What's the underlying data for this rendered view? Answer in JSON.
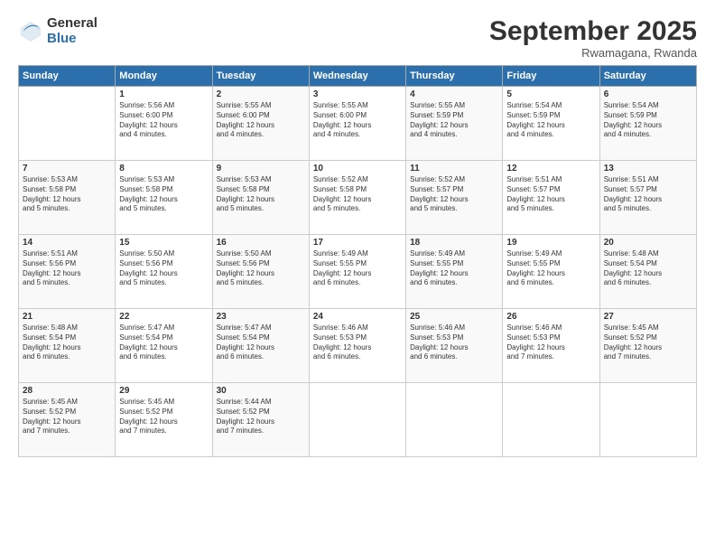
{
  "logo": {
    "general": "General",
    "blue": "Blue"
  },
  "header": {
    "month": "September 2025",
    "location": "Rwamagana, Rwanda"
  },
  "days": [
    "Sunday",
    "Monday",
    "Tuesday",
    "Wednesday",
    "Thursday",
    "Friday",
    "Saturday"
  ],
  "weeks": [
    [
      {
        "num": "",
        "lines": []
      },
      {
        "num": "1",
        "lines": [
          "Sunrise: 5:56 AM",
          "Sunset: 6:00 PM",
          "Daylight: 12 hours",
          "and 4 minutes."
        ]
      },
      {
        "num": "2",
        "lines": [
          "Sunrise: 5:55 AM",
          "Sunset: 6:00 PM",
          "Daylight: 12 hours",
          "and 4 minutes."
        ]
      },
      {
        "num": "3",
        "lines": [
          "Sunrise: 5:55 AM",
          "Sunset: 6:00 PM",
          "Daylight: 12 hours",
          "and 4 minutes."
        ]
      },
      {
        "num": "4",
        "lines": [
          "Sunrise: 5:55 AM",
          "Sunset: 5:59 PM",
          "Daylight: 12 hours",
          "and 4 minutes."
        ]
      },
      {
        "num": "5",
        "lines": [
          "Sunrise: 5:54 AM",
          "Sunset: 5:59 PM",
          "Daylight: 12 hours",
          "and 4 minutes."
        ]
      },
      {
        "num": "6",
        "lines": [
          "Sunrise: 5:54 AM",
          "Sunset: 5:59 PM",
          "Daylight: 12 hours",
          "and 4 minutes."
        ]
      }
    ],
    [
      {
        "num": "7",
        "lines": [
          "Sunrise: 5:53 AM",
          "Sunset: 5:58 PM",
          "Daylight: 12 hours",
          "and 5 minutes."
        ]
      },
      {
        "num": "8",
        "lines": [
          "Sunrise: 5:53 AM",
          "Sunset: 5:58 PM",
          "Daylight: 12 hours",
          "and 5 minutes."
        ]
      },
      {
        "num": "9",
        "lines": [
          "Sunrise: 5:53 AM",
          "Sunset: 5:58 PM",
          "Daylight: 12 hours",
          "and 5 minutes."
        ]
      },
      {
        "num": "10",
        "lines": [
          "Sunrise: 5:52 AM",
          "Sunset: 5:58 PM",
          "Daylight: 12 hours",
          "and 5 minutes."
        ]
      },
      {
        "num": "11",
        "lines": [
          "Sunrise: 5:52 AM",
          "Sunset: 5:57 PM",
          "Daylight: 12 hours",
          "and 5 minutes."
        ]
      },
      {
        "num": "12",
        "lines": [
          "Sunrise: 5:51 AM",
          "Sunset: 5:57 PM",
          "Daylight: 12 hours",
          "and 5 minutes."
        ]
      },
      {
        "num": "13",
        "lines": [
          "Sunrise: 5:51 AM",
          "Sunset: 5:57 PM",
          "Daylight: 12 hours",
          "and 5 minutes."
        ]
      }
    ],
    [
      {
        "num": "14",
        "lines": [
          "Sunrise: 5:51 AM",
          "Sunset: 5:56 PM",
          "Daylight: 12 hours",
          "and 5 minutes."
        ]
      },
      {
        "num": "15",
        "lines": [
          "Sunrise: 5:50 AM",
          "Sunset: 5:56 PM",
          "Daylight: 12 hours",
          "and 5 minutes."
        ]
      },
      {
        "num": "16",
        "lines": [
          "Sunrise: 5:50 AM",
          "Sunset: 5:56 PM",
          "Daylight: 12 hours",
          "and 5 minutes."
        ]
      },
      {
        "num": "17",
        "lines": [
          "Sunrise: 5:49 AM",
          "Sunset: 5:55 PM",
          "Daylight: 12 hours",
          "and 6 minutes."
        ]
      },
      {
        "num": "18",
        "lines": [
          "Sunrise: 5:49 AM",
          "Sunset: 5:55 PM",
          "Daylight: 12 hours",
          "and 6 minutes."
        ]
      },
      {
        "num": "19",
        "lines": [
          "Sunrise: 5:49 AM",
          "Sunset: 5:55 PM",
          "Daylight: 12 hours",
          "and 6 minutes."
        ]
      },
      {
        "num": "20",
        "lines": [
          "Sunrise: 5:48 AM",
          "Sunset: 5:54 PM",
          "Daylight: 12 hours",
          "and 6 minutes."
        ]
      }
    ],
    [
      {
        "num": "21",
        "lines": [
          "Sunrise: 5:48 AM",
          "Sunset: 5:54 PM",
          "Daylight: 12 hours",
          "and 6 minutes."
        ]
      },
      {
        "num": "22",
        "lines": [
          "Sunrise: 5:47 AM",
          "Sunset: 5:54 PM",
          "Daylight: 12 hours",
          "and 6 minutes."
        ]
      },
      {
        "num": "23",
        "lines": [
          "Sunrise: 5:47 AM",
          "Sunset: 5:54 PM",
          "Daylight: 12 hours",
          "and 6 minutes."
        ]
      },
      {
        "num": "24",
        "lines": [
          "Sunrise: 5:46 AM",
          "Sunset: 5:53 PM",
          "Daylight: 12 hours",
          "and 6 minutes."
        ]
      },
      {
        "num": "25",
        "lines": [
          "Sunrise: 5:46 AM",
          "Sunset: 5:53 PM",
          "Daylight: 12 hours",
          "and 6 minutes."
        ]
      },
      {
        "num": "26",
        "lines": [
          "Sunrise: 5:46 AM",
          "Sunset: 5:53 PM",
          "Daylight: 12 hours",
          "and 7 minutes."
        ]
      },
      {
        "num": "27",
        "lines": [
          "Sunrise: 5:45 AM",
          "Sunset: 5:52 PM",
          "Daylight: 12 hours",
          "and 7 minutes."
        ]
      }
    ],
    [
      {
        "num": "28",
        "lines": [
          "Sunrise: 5:45 AM",
          "Sunset: 5:52 PM",
          "Daylight: 12 hours",
          "and 7 minutes."
        ]
      },
      {
        "num": "29",
        "lines": [
          "Sunrise: 5:45 AM",
          "Sunset: 5:52 PM",
          "Daylight: 12 hours",
          "and 7 minutes."
        ]
      },
      {
        "num": "30",
        "lines": [
          "Sunrise: 5:44 AM",
          "Sunset: 5:52 PM",
          "Daylight: 12 hours",
          "and 7 minutes."
        ]
      },
      {
        "num": "",
        "lines": []
      },
      {
        "num": "",
        "lines": []
      },
      {
        "num": "",
        "lines": []
      },
      {
        "num": "",
        "lines": []
      }
    ]
  ]
}
